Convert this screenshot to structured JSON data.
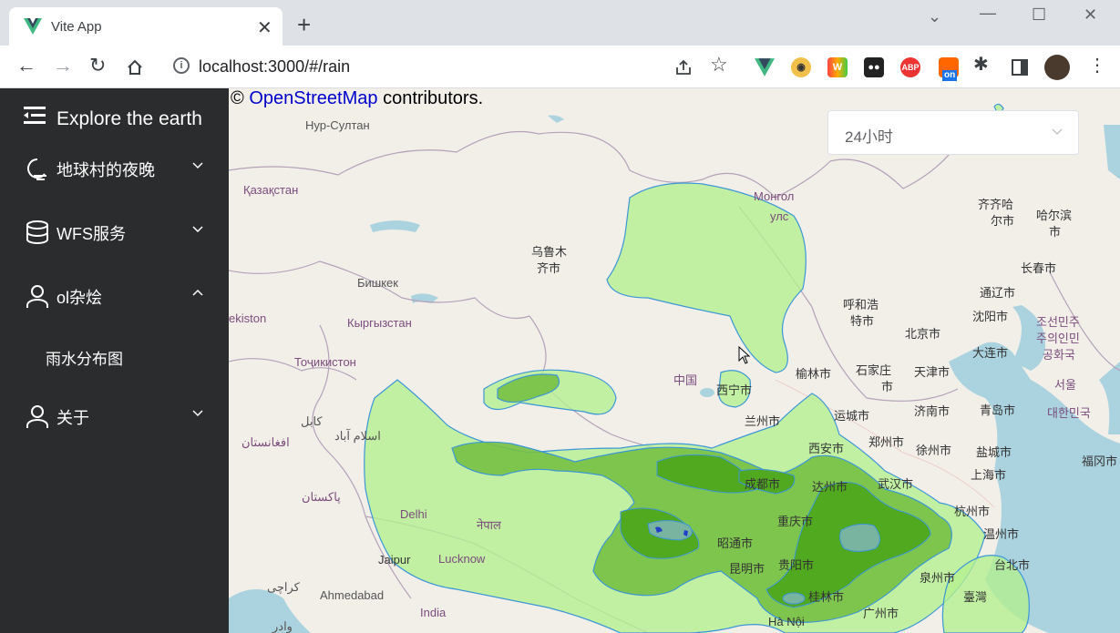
{
  "browser": {
    "tab_title": "Vite App",
    "url": "localhost:3000/#/rain"
  },
  "sidebar": {
    "brand": "Explore the earth",
    "items": [
      {
        "label": "地球村的夜晚"
      },
      {
        "label": "WFS服务"
      },
      {
        "label": "ol杂烩"
      },
      {
        "label": "关于"
      }
    ],
    "subitem": "雨水分布图"
  },
  "map": {
    "attribution_prefix": "©",
    "attribution_link": "OpenStreetMap",
    "attribution_suffix": "contributors.",
    "select_value": "24小时",
    "labels": [
      "Нур-Султан",
      "Қазақстан",
      "Монгол",
      "улс",
      "齐齐哈",
      "尔市",
      "哈尔滨",
      "市",
      "乌鲁木",
      "齐市",
      "长春市",
      "Бишкек",
      "通辽市",
      "呼和浩",
      "特市",
      "沈阳市",
      "조선민주",
      "주의인민",
      "공화국",
      "ekiston",
      "Кыргызстан",
      "北京市",
      "大连市",
      "Тоҷикистон",
      "中国",
      "榆林市",
      "石家庄",
      "天津市",
      "市",
      "西宁市",
      "서울",
      "兰州市",
      "运城市",
      "济南市",
      "青岛市",
      "대한민국",
      "کابل",
      "اسلام آباد",
      "افغانستان",
      "西安市",
      "郑州市",
      "徐州市",
      "盐城市",
      "成都市",
      "达州市",
      "武汉市",
      "上海市",
      "福冈市",
      "پاکستان",
      "Delhi",
      "नेपाल",
      "重庆市",
      "杭州市",
      "温州市",
      "昭通市",
      "Jaipur",
      "Lucknow",
      "昆明市",
      "贵阳市",
      "泉州市",
      "台北市",
      "کراچی",
      "Ahmedabad",
      "桂林市",
      "广州市",
      "India",
      "Hà Nội",
      "臺灣",
      "وادر"
    ]
  }
}
